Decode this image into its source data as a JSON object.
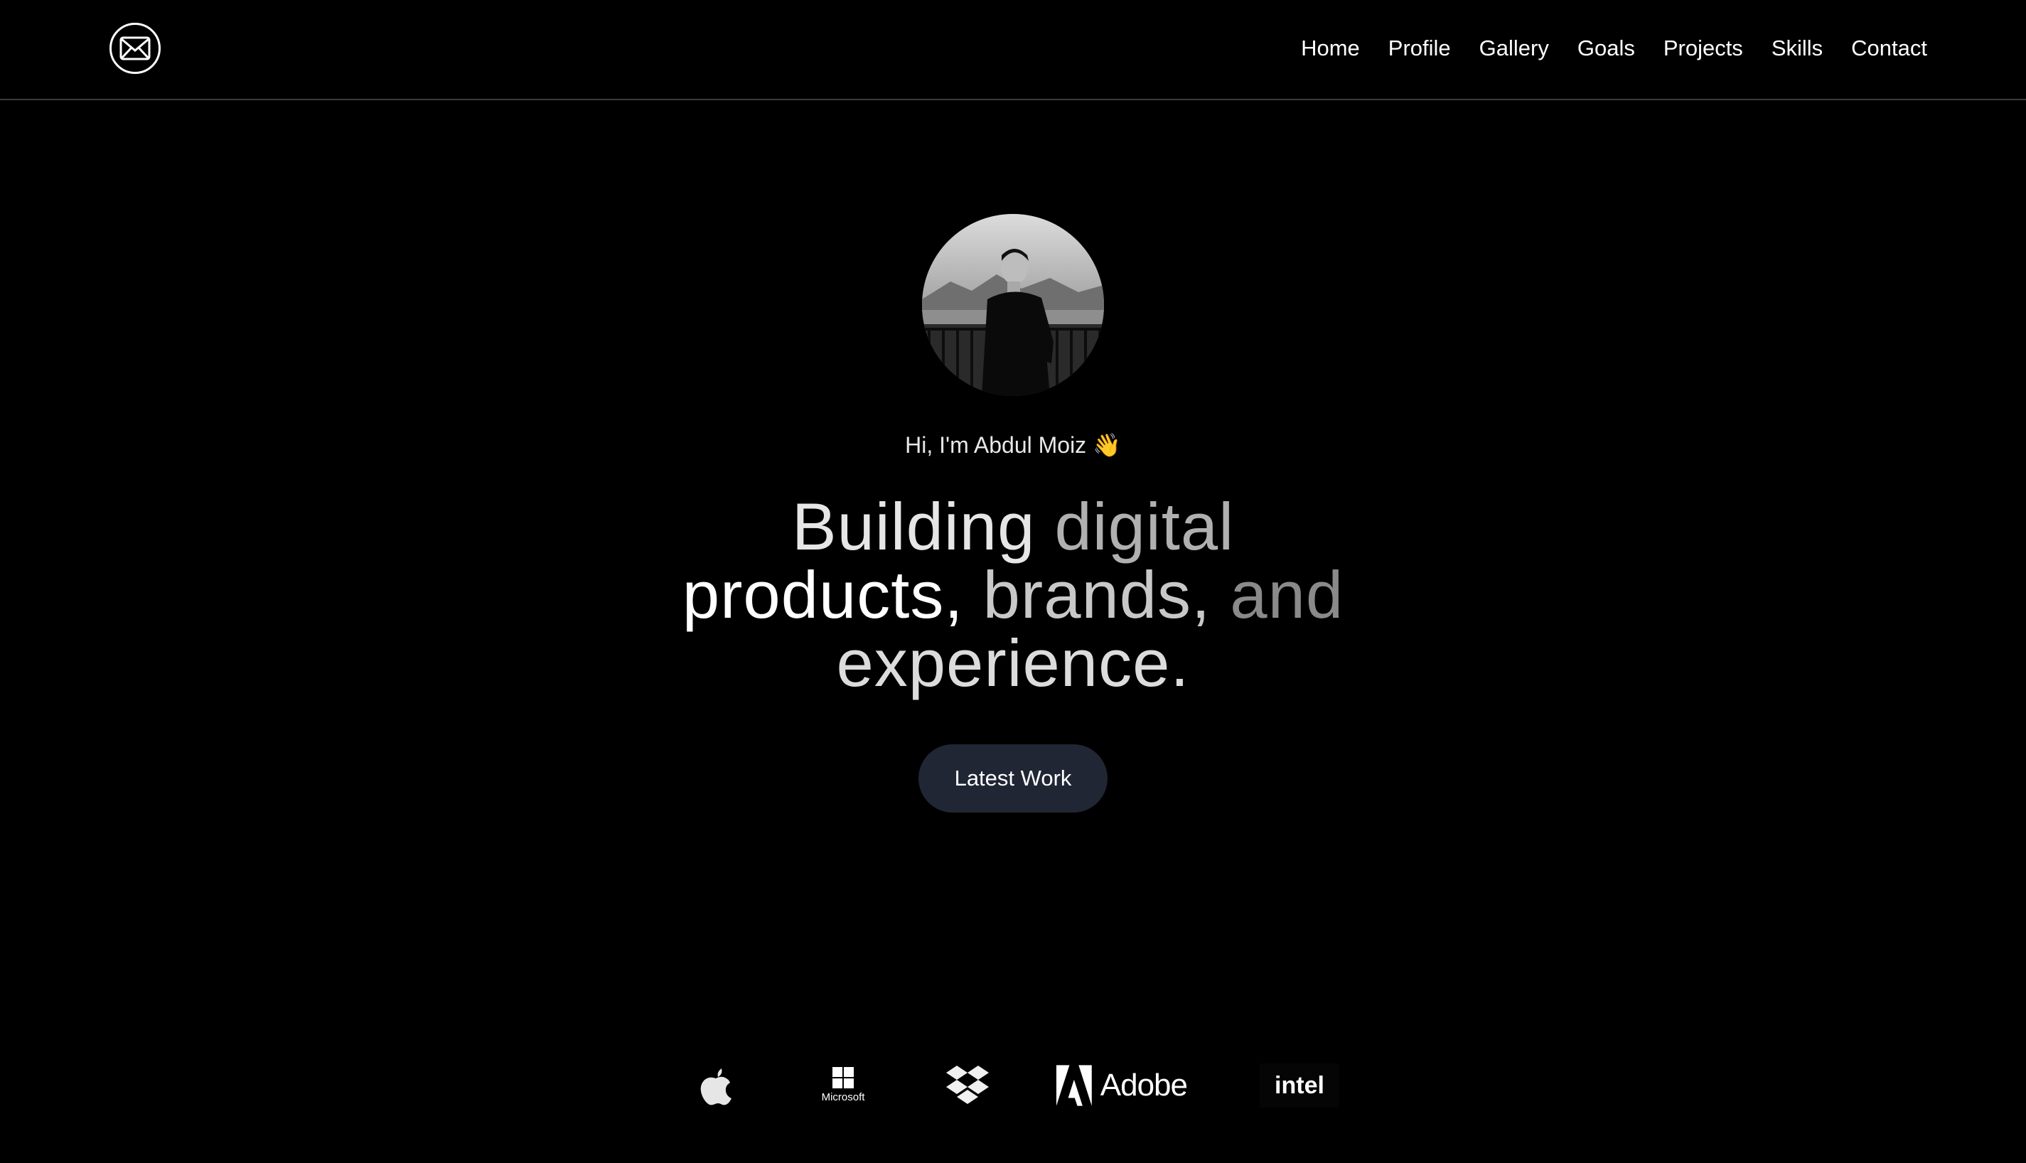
{
  "nav": {
    "logo_icon": "envelope-icon",
    "links": [
      "Home",
      "Profile",
      "Gallery",
      "Goals",
      "Projects",
      "Skills",
      "Contact"
    ]
  },
  "hero": {
    "avatar_icon": "profile-photo",
    "greeting": "Hi, I'm Abdul Moiz 👋",
    "headline": {
      "line1": [
        "Building",
        "digital"
      ],
      "line2": [
        "products,",
        "brands,",
        "and"
      ],
      "line3": [
        "experience."
      ]
    },
    "cta_label": "Latest Work"
  },
  "brands": [
    {
      "name": "apple-logo",
      "label": ""
    },
    {
      "name": "microsoft-logo",
      "label": "Microsoft"
    },
    {
      "name": "dropbox-logo",
      "label": ""
    },
    {
      "name": "adobe-logo",
      "label": "Adobe"
    },
    {
      "name": "intel-logo",
      "label": "intel"
    }
  ],
  "colors": {
    "background": "#000000",
    "button": "#202633",
    "divider": "#3a3a3a"
  }
}
